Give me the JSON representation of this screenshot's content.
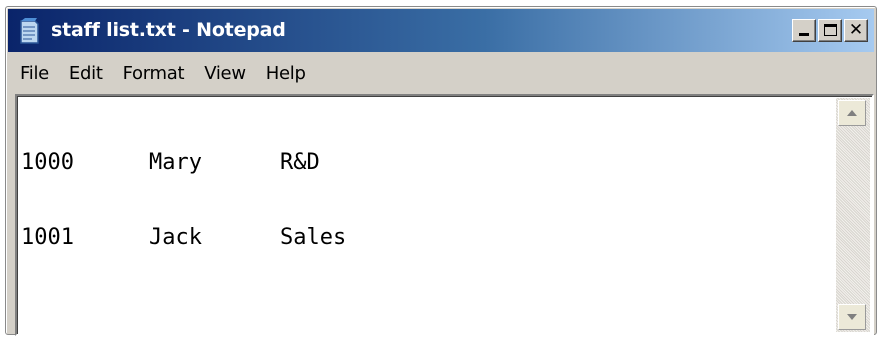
{
  "window": {
    "title": "staff list.txt - Notepad",
    "icon": "notepad-icon",
    "controls": {
      "minimize": "minimize-icon",
      "maximize": "maximize-icon",
      "close": "close-icon"
    }
  },
  "menu": {
    "items": [
      {
        "label": "File"
      },
      {
        "label": "Edit"
      },
      {
        "label": "Format"
      },
      {
        "label": "View"
      },
      {
        "label": "Help"
      }
    ]
  },
  "document": {
    "lines": [
      {
        "id": "1000",
        "name": "Mary",
        "dept": "R&D"
      },
      {
        "id": "1001",
        "name": "Jack",
        "dept": "Sales"
      }
    ]
  },
  "colors": {
    "titlebar_start": "#0a246a",
    "titlebar_end": "#a6caf0",
    "chrome": "#d4d0c8",
    "editor_bg": "#ffffff"
  }
}
